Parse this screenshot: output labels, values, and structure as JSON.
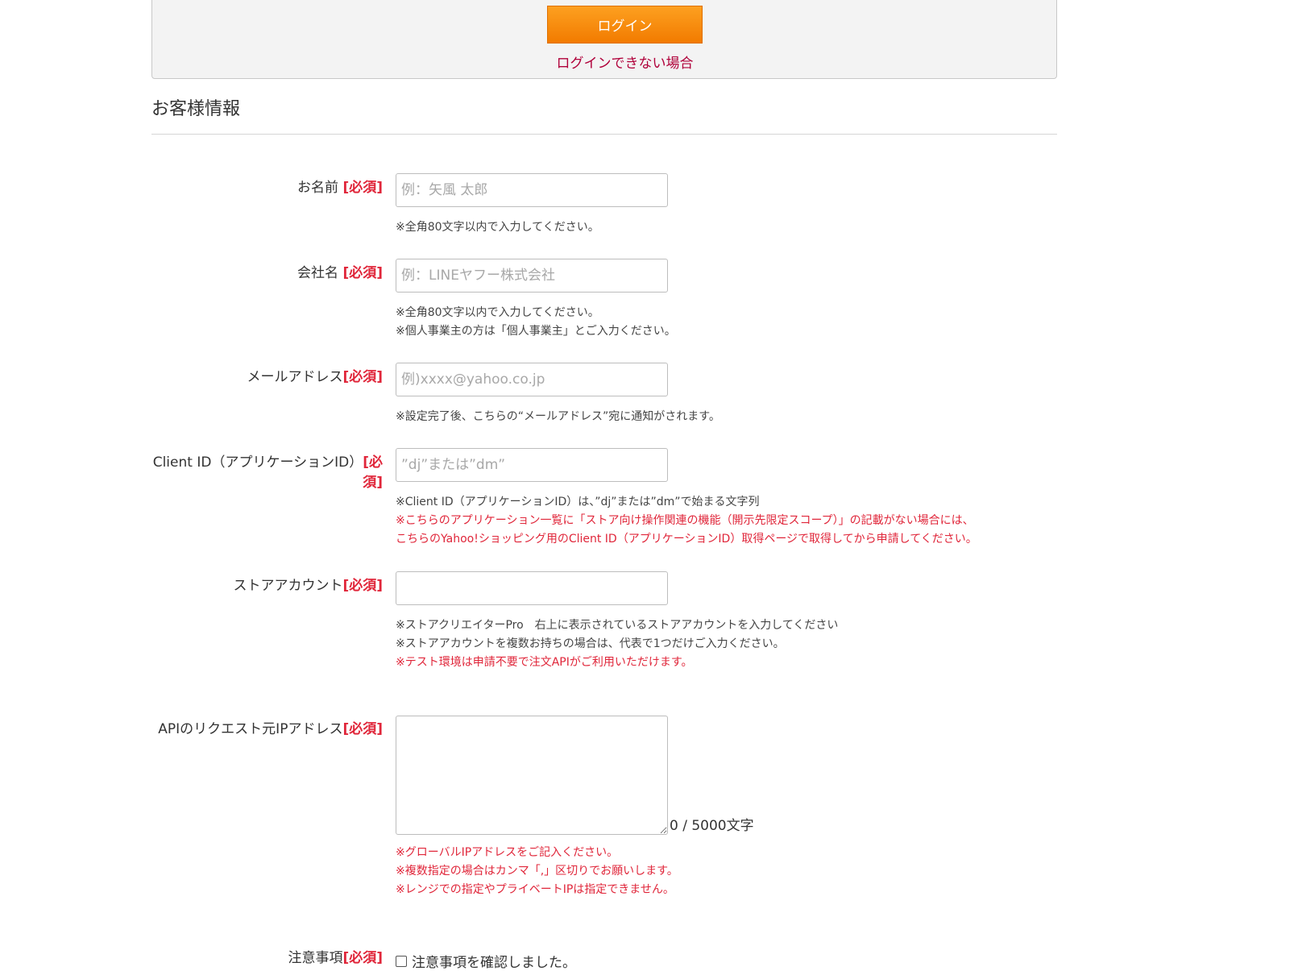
{
  "login": {
    "button_label": "ログイン",
    "help_link": "ログインできない場合"
  },
  "section": {
    "title": "お客様情報"
  },
  "required_label": "[必須]",
  "fields": {
    "name": {
      "label": "お名前 ",
      "placeholder": "例：矢風 太郎",
      "notes": [
        "※全角80文字以内で入力してください。"
      ]
    },
    "company": {
      "label": "会社名 ",
      "placeholder": "例：LINEヤフー株式会社",
      "notes": [
        "※全角80文字以内で入力してください。",
        "※個人事業主の方は「個人事業主」とご入力ください。"
      ]
    },
    "email": {
      "label": "メールアドレス",
      "placeholder": "例)xxxx@yahoo.co.jp",
      "notes": [
        "※設定完了後、こちらの“メールアドレス”宛に通知がされます。"
      ]
    },
    "client_id": {
      "label": "Client ID（アプリケーションID）",
      "placeholder": "”dj”または”dm”",
      "notes": [
        "※Client ID（アプリケーションID）は、”dj”または”dm”で始まる文字列"
      ],
      "red_notes": [
        "※こちらのアプリケーション一覧に「ストア向け操作関連の機能（開示先限定スコープ）」の記載がない場合には、",
        "こちらのYahoo!ショッピング用のClient ID（アプリケーションID）取得ページで取得してから申請してください。"
      ]
    },
    "store_account": {
      "label": "ストアアカウント",
      "placeholder": "",
      "notes": [
        "※ストアクリエイターPro　右上に表示されているストアアカウントを入力してください",
        "※ストアアカウントを複数お持ちの場合は、代表で1つだけご入力ください。"
      ],
      "red_notes": [
        "※テスト環境は申請不要で注文APIがご利用いただけます。"
      ]
    },
    "ip_address": {
      "label": "APIのリクエスト元IPアドレス",
      "counter": "0 / 5000文字",
      "red_notes": [
        "※グローバルIPアドレスをご記入ください。",
        "※複数指定の場合はカンマ「,」区切りでお願いします。",
        "※レンジでの指定やプライベートIPは指定できません。"
      ]
    },
    "notice": {
      "label": "注意事項",
      "checkbox_label": "注意事項を確認しました。"
    }
  }
}
